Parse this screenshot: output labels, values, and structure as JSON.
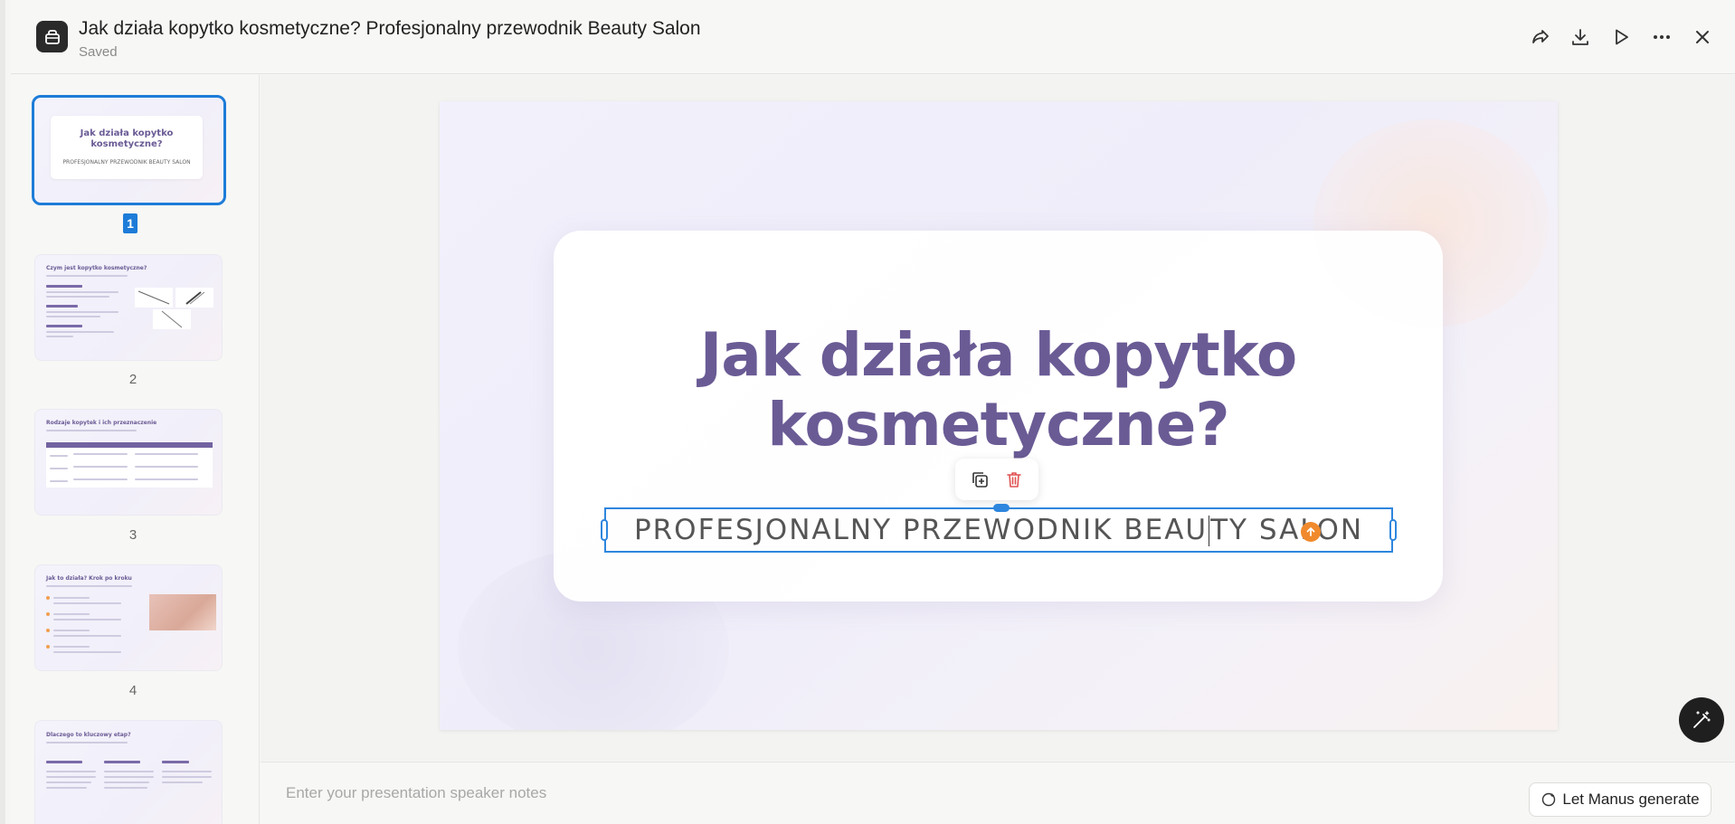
{
  "header": {
    "title": "Jak działa kopytko kosmetyczne? Profesjonalny przewodnik Beauty Salon",
    "status": "Saved",
    "actions": [
      "share-icon",
      "download-icon",
      "play-icon",
      "more-icon",
      "close-icon"
    ]
  },
  "sidebar": {
    "slides": [
      {
        "number": "1",
        "title": "Jak działa kopytko kosmetyczne?",
        "subtitle": "PROFESJONALNY PRZEWODNIK BEAUTY SALON"
      },
      {
        "number": "2",
        "title": "Czym jest kopytko kosmetyczne?"
      },
      {
        "number": "3",
        "title": "Rodzaje kopytek i ich przeznaczenie"
      },
      {
        "number": "4",
        "title": "Jak to działa? Krok po kroku"
      },
      {
        "number": "",
        "title": "Dlaczego to kluczowy etap?"
      }
    ]
  },
  "slide": {
    "title_line1": "Jak działa kopytko",
    "title_line2": "kosmetyczne?",
    "subtitle_before_caret": "PROFESJONALNY PRZEWODNIK BEAU",
    "subtitle_after_caret": "TY SALON"
  },
  "notes": {
    "placeholder": "Enter your presentation speaker notes",
    "generate_label": "Let Manus generate"
  },
  "colors": {
    "accent": "#1d7cd8",
    "title": "#6a5b95",
    "delete": "#e05252",
    "orange": "#f08a2c"
  }
}
